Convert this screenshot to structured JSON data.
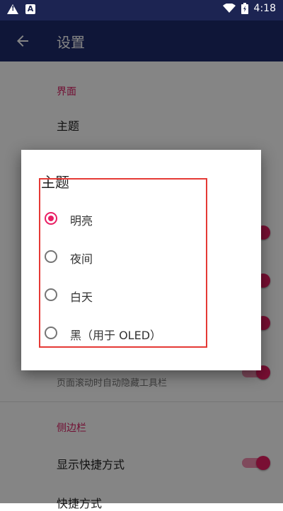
{
  "status_bar": {
    "time": "4:18",
    "left_icons": [
      "warning-icon",
      "a-icon"
    ],
    "right_icons": [
      "wifi-icon",
      "battery-icon"
    ]
  },
  "toolbar": {
    "title": "设置",
    "back_icon": "arrow-left-icon"
  },
  "settings": {
    "section_interface": "界面",
    "theme_item": "主题",
    "hide_toolbar_sub": "页面滚动时自动隐藏工具栏",
    "section_sidebar": "侧边栏",
    "show_shortcuts": "显示快捷方式",
    "shortcut_style": "快捷方式"
  },
  "dialog": {
    "title": "主题",
    "options": [
      {
        "label": "明亮",
        "selected": true
      },
      {
        "label": "夜间",
        "selected": false
      },
      {
        "label": "白天",
        "selected": false
      },
      {
        "label": "黑（用于 OLED）",
        "selected": false
      }
    ]
  },
  "colors": {
    "statusbar": "#1c2452",
    "toolbar": "#1e2b6c",
    "accent": "#e91e63",
    "section": "#d81b60",
    "highlight": "#e53935"
  }
}
